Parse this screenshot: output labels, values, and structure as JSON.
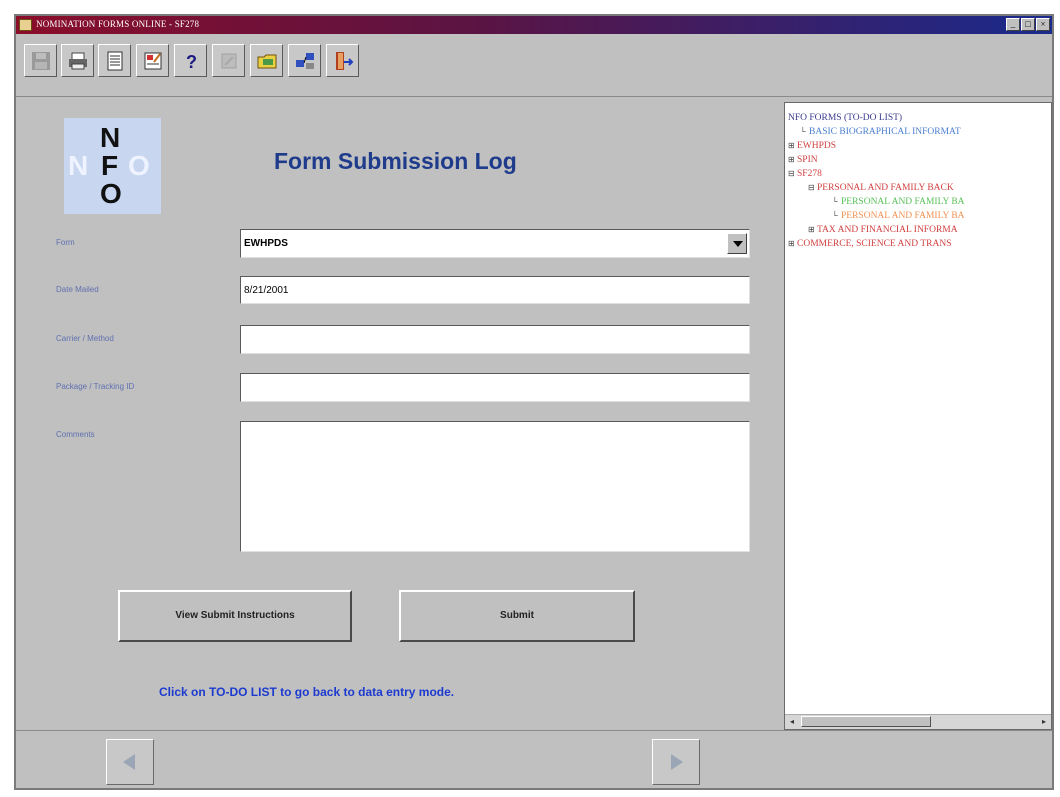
{
  "window": {
    "title": "NOMINATION FORMS ONLINE - SF278",
    "controls": [
      "minimize",
      "maximize",
      "close"
    ]
  },
  "toolbar": {
    "buttons": [
      {
        "name": "save-icon",
        "enabled": false
      },
      {
        "name": "print-icon",
        "enabled": true
      },
      {
        "name": "document-icon",
        "enabled": true
      },
      {
        "name": "edit-form-icon",
        "enabled": true
      },
      {
        "name": "help-icon",
        "enabled": true,
        "glyph": "?"
      },
      {
        "name": "disabled-tool-icon",
        "enabled": false
      },
      {
        "name": "folder-icon",
        "enabled": true
      },
      {
        "name": "network-icon",
        "enabled": true
      },
      {
        "name": "exit-icon",
        "enabled": true
      }
    ]
  },
  "logo": {
    "letters": [
      "N",
      "F",
      "O"
    ],
    "faded_letters": [
      "N",
      "F",
      "O"
    ]
  },
  "page": {
    "title": "Form Submission Log"
  },
  "form": {
    "form_label": "Form",
    "form_value": "EWHPDS",
    "date_label": "Date Mailed",
    "date_value": "8/21/2001",
    "carrier_label": "Carrier / Method",
    "carrier_value": "",
    "package_label": "Package / Tracking ID",
    "package_value": "",
    "comments_label": "Comments",
    "comments_value": ""
  },
  "actions": {
    "view_instructions_label": "View Submit Instructions",
    "submit_label": "Submit"
  },
  "hint": "Click on TO-DO LIST to go back to data entry mode.",
  "tree": {
    "root": "NFO FORMS (TO-DO LIST)",
    "nodes": [
      {
        "label": "BASIC BIOGRAPHICAL INFORMAT",
        "marker": "└",
        "color": "#4a7fd0",
        "indent": 12
      },
      {
        "label": "EWHPDS",
        "marker": "⊞",
        "color": "#d04040",
        "indent": 0
      },
      {
        "label": "SPIN",
        "marker": "⊞",
        "color": "#d04040",
        "indent": 0
      },
      {
        "label": "SF278",
        "marker": "⊟",
        "color": "#d04040",
        "indent": 0
      },
      {
        "label": "PERSONAL AND FAMILY BACK",
        "marker": "⊟",
        "color": "#d04040",
        "indent": 20
      },
      {
        "label": "PERSONAL AND FAMILY BA",
        "marker": "└",
        "color": "#58c058",
        "indent": 44
      },
      {
        "label": "PERSONAL AND FAMILY BA",
        "marker": "└",
        "color": "#f09050",
        "indent": 44
      },
      {
        "label": "TAX AND FINANCIAL INFORMA",
        "marker": "⊞",
        "color": "#d04040",
        "indent": 20
      },
      {
        "label": "COMMERCE, SCIENCE AND TRANS",
        "marker": "⊞",
        "color": "#d04040",
        "indent": 0
      }
    ]
  },
  "colors": {
    "title_blue": "#1e3b8c",
    "hint_blue": "#1c3ad0",
    "label_blue": "#6070b0",
    "tree_red": "#d04040"
  }
}
